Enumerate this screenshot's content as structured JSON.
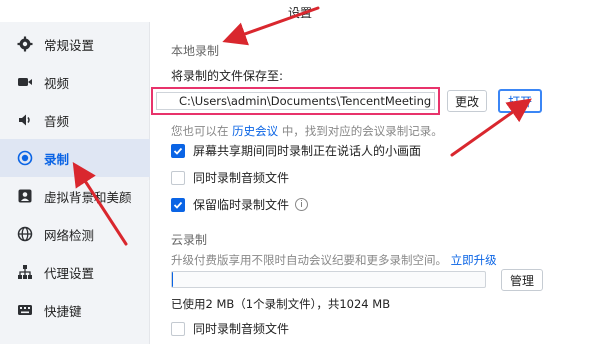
{
  "window": {
    "title": "设置"
  },
  "sidebar": {
    "items": [
      {
        "label": "常规设置",
        "icon": "gear-icon",
        "active": false
      },
      {
        "label": "视频",
        "icon": "video-camera-icon",
        "active": false
      },
      {
        "label": "音频",
        "icon": "speaker-icon",
        "active": false
      },
      {
        "label": "录制",
        "icon": "record-icon",
        "active": true
      },
      {
        "label": "虚拟背景和美颜",
        "icon": "portrait-icon",
        "active": false
      },
      {
        "label": "网络检测",
        "icon": "globe-icon",
        "active": false
      },
      {
        "label": "代理设置",
        "icon": "network-hierarchy-icon",
        "active": false
      },
      {
        "label": "快捷键",
        "icon": "keyboard-icon",
        "active": false
      }
    ]
  },
  "local_recording": {
    "section_title": "本地录制",
    "save_label": "将录制的文件保存至:",
    "path_value": "C:\\Users\\admin\\Documents\\TencentMeeting",
    "change_button": "更改",
    "open_button": "打开",
    "hint_prefix": "您也可以在",
    "hint_link": "历史会议",
    "hint_suffix": "中，找到对应的会议录制记录。",
    "options": [
      {
        "label": "屏幕共享期间同时录制正在说话人的小画面",
        "checked": true
      },
      {
        "label": "同时录制音频文件",
        "checked": false
      },
      {
        "label": "保留临时录制文件",
        "checked": true
      }
    ]
  },
  "cloud_recording": {
    "section_title": "云录制",
    "hint": "升级付费版享用不限时自动会议纪要和更多录制空间。",
    "upgrade_link": "立即升级",
    "usage_fraction": 0.002,
    "manage_button": "管理",
    "usage_text": "已使用2 MB（1个录制文件），共1024 MB",
    "audio_option": {
      "label": "同时录制音频文件",
      "checked": false
    }
  },
  "colors": {
    "accent": "#0a64e5",
    "highlight_box": "#e8336b",
    "annotation_arrow": "#d9272e"
  }
}
